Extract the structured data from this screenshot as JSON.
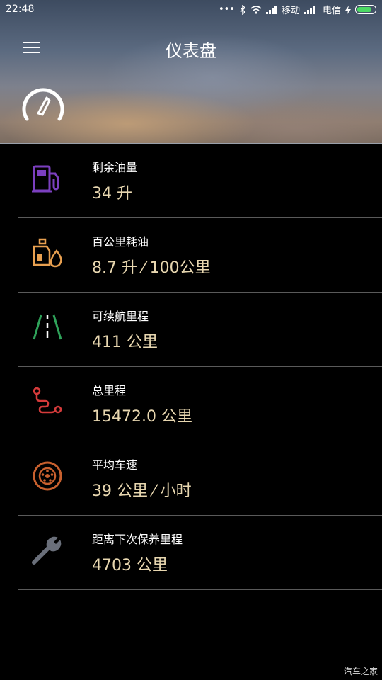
{
  "status_bar": {
    "time": "22:48",
    "carrier1": "移动",
    "carrier2": "电信",
    "battery_color": "#4cd964"
  },
  "header": {
    "title": "仪表盘",
    "menu_icon": "hamburger-icon",
    "hero_icon": "speedometer-icon"
  },
  "items": [
    {
      "label": "剩余油量",
      "value": "34 升",
      "icon": "fuel-pump-icon",
      "color": "#7b3fbf"
    },
    {
      "label": "百公里耗油",
      "value": "8.7 升 ⁄ 100公里",
      "icon": "oil-can-icon",
      "color": "#e8a050"
    },
    {
      "label": "可续航里程",
      "value": "411 公里",
      "icon": "road-icon",
      "color": "#2fa35a"
    },
    {
      "label": "总里程",
      "value": "15472.0 公里",
      "icon": "route-icon",
      "color": "#d53b3b"
    },
    {
      "label": "平均车速",
      "value": "39 公里 ⁄ 小时",
      "icon": "wheel-icon",
      "color": "#c8602e"
    },
    {
      "label": "距离下次保养里程",
      "value": "4703 公里",
      "icon": "wrench-icon",
      "color": "#6a6f7a"
    }
  ],
  "watermark": "汽车之家"
}
